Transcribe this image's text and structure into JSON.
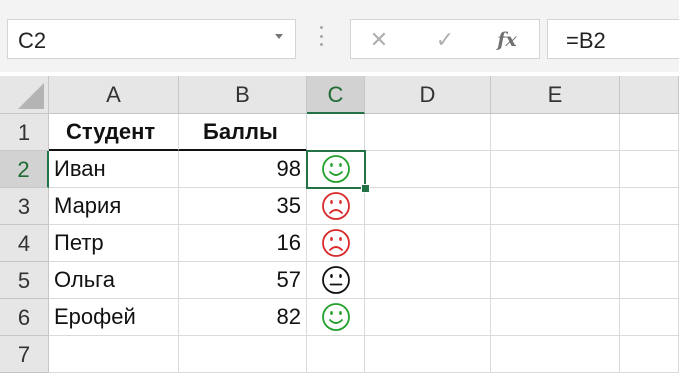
{
  "formula_bar": {
    "name_box": "C2",
    "cancel_icon": "close-icon",
    "enter_icon": "check-icon",
    "fx_label": "fx",
    "formula": "=B2"
  },
  "columns": [
    "A",
    "B",
    "C",
    "D",
    "E"
  ],
  "rows": [
    "1",
    "2",
    "3",
    "4",
    "5",
    "6",
    "7"
  ],
  "selected_cell": "C2",
  "table": {
    "header": {
      "col_a": "Студент",
      "col_b": "Баллы"
    },
    "records": [
      {
        "name": "Иван",
        "score": "98",
        "icon": "smiley-happy-icon",
        "color": "#22a02c"
      },
      {
        "name": "Мария",
        "score": "35",
        "icon": "smiley-sad-icon",
        "color": "#d82a2a"
      },
      {
        "name": "Петр",
        "score": "16",
        "icon": "smiley-sad-icon",
        "color": "#d82a2a"
      },
      {
        "name": "Ольга",
        "score": "57",
        "icon": "smiley-neutral-icon",
        "color": "#111111"
      },
      {
        "name": "Ерофей",
        "score": "82",
        "icon": "smiley-happy-icon",
        "color": "#22a02c"
      }
    ]
  },
  "colors": {
    "accent": "#217346",
    "header_bg": "#e6e6e6",
    "header_selected_bg": "#d2d2d2"
  }
}
